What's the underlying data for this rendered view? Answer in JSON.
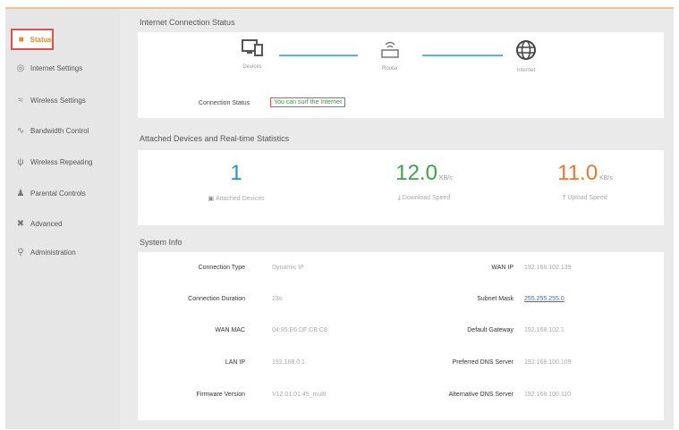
{
  "sidebar": {
    "items": [
      {
        "label": "Status",
        "icon": "status-icon"
      },
      {
        "label": "Internet Settings",
        "icon": "globe-icon"
      },
      {
        "label": "Wireless Settings",
        "icon": "wifi-icon"
      },
      {
        "label": "Bandwidth Control",
        "icon": "bandwidth-icon"
      },
      {
        "label": "Wireless Repeating",
        "icon": "antenna-icon"
      },
      {
        "label": "Parental Controls",
        "icon": "parental-icon"
      },
      {
        "label": "Advanced",
        "icon": "tools-icon"
      },
      {
        "label": "Administration",
        "icon": "admin-icon"
      }
    ]
  },
  "connection": {
    "section_title": "Internet Connection Status",
    "devices_label": "Devices",
    "router_label": "Router",
    "internet_label": "Internet",
    "status_label": "Connection Status",
    "status_value": "You can surf the Internet"
  },
  "stats": {
    "section_title": "Attached Devices and Real-time Statistics",
    "attached_value": "1",
    "attached_label": "Attached Devices",
    "download_value": "12.0",
    "download_unit": "KB/s",
    "download_label": "Download Speed",
    "upload_value": "11.0",
    "upload_unit": "KB/s",
    "upload_label": "Upload Speed",
    "colors": {
      "attached": "#2a8fd0",
      "download": "#3aa64a",
      "upload": "#e8792e"
    }
  },
  "system": {
    "section_title": "System Info",
    "left": [
      {
        "label": "Connection Type",
        "value": "Dynamic IP"
      },
      {
        "label": "Connection Duration",
        "value": "23s"
      },
      {
        "label": "WAN MAC",
        "value": "04:95:E6:DF:CB:C8"
      },
      {
        "label": "LAN IP",
        "value": "192.168.0.1"
      },
      {
        "label": "Firmware Version",
        "value": "V12.01.01.45_multi"
      }
    ],
    "right": [
      {
        "label": "WAN IP",
        "value": "192.168.102.139"
      },
      {
        "label": "Subnet Mask",
        "value": "255.255.255.0"
      },
      {
        "label": "Default Gateway",
        "value": "192.168.102.1"
      },
      {
        "label": "Preferred DNS Server",
        "value": "192.168.100.109"
      },
      {
        "label": "Alternative DNS Server",
        "value": "192.168.100.110"
      }
    ]
  }
}
